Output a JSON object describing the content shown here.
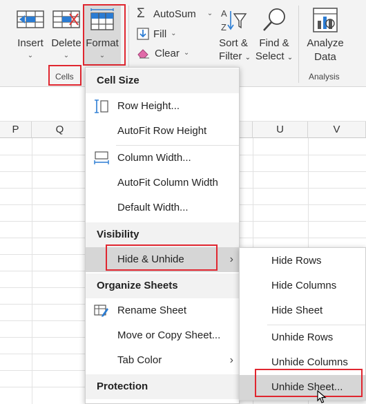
{
  "ribbon": {
    "insert": {
      "label": "Insert",
      "caret": "⌄"
    },
    "delete": {
      "label": "Delete",
      "caret": "⌄"
    },
    "format": {
      "label": "Format",
      "caret": "⌄"
    },
    "cells_group": "Cells",
    "autosum": {
      "label": "AutoSum",
      "caret": "⌄"
    },
    "fill": {
      "label": "Fill",
      "caret": "⌄"
    },
    "clear": {
      "label": "Clear",
      "caret": "⌄"
    },
    "sort_filter": {
      "line1": "Sort &",
      "line2": "Filter",
      "caret": "⌄"
    },
    "find_select": {
      "line1": "Find &",
      "line2": "Select",
      "caret": "⌄"
    },
    "analyze": {
      "line1": "Analyze",
      "line2": "Data"
    },
    "analysis_group": "Analysis"
  },
  "columns": [
    "P",
    "Q",
    "U",
    "V"
  ],
  "format_menu": {
    "cell_size_header": "Cell Size",
    "row_height": "Row Height...",
    "autofit_row_height": "AutoFit Row Height",
    "column_width": "Column Width...",
    "autofit_column_width": "AutoFit Column Width",
    "default_width": "Default Width...",
    "visibility_header": "Visibility",
    "hide_unhide": "Hide & Unhide",
    "organize_header": "Organize Sheets",
    "rename_sheet": "Rename Sheet",
    "move_copy_sheet": "Move or Copy Sheet...",
    "tab_color": "Tab Color",
    "protection_header": "Protection",
    "submenu_arrow": "›"
  },
  "hide_unhide_menu": {
    "hide_rows": "Hide Rows",
    "hide_columns": "Hide Columns",
    "hide_sheet": "Hide Sheet",
    "unhide_rows": "Unhide Rows",
    "unhide_columns": "Unhide Columns",
    "unhide_sheet": "Unhide Sheet..."
  },
  "colors": {
    "highlight_red": "#e0262f",
    "accent_blue": "#2b7cd3",
    "menu_hover": "#d6d6d6"
  }
}
